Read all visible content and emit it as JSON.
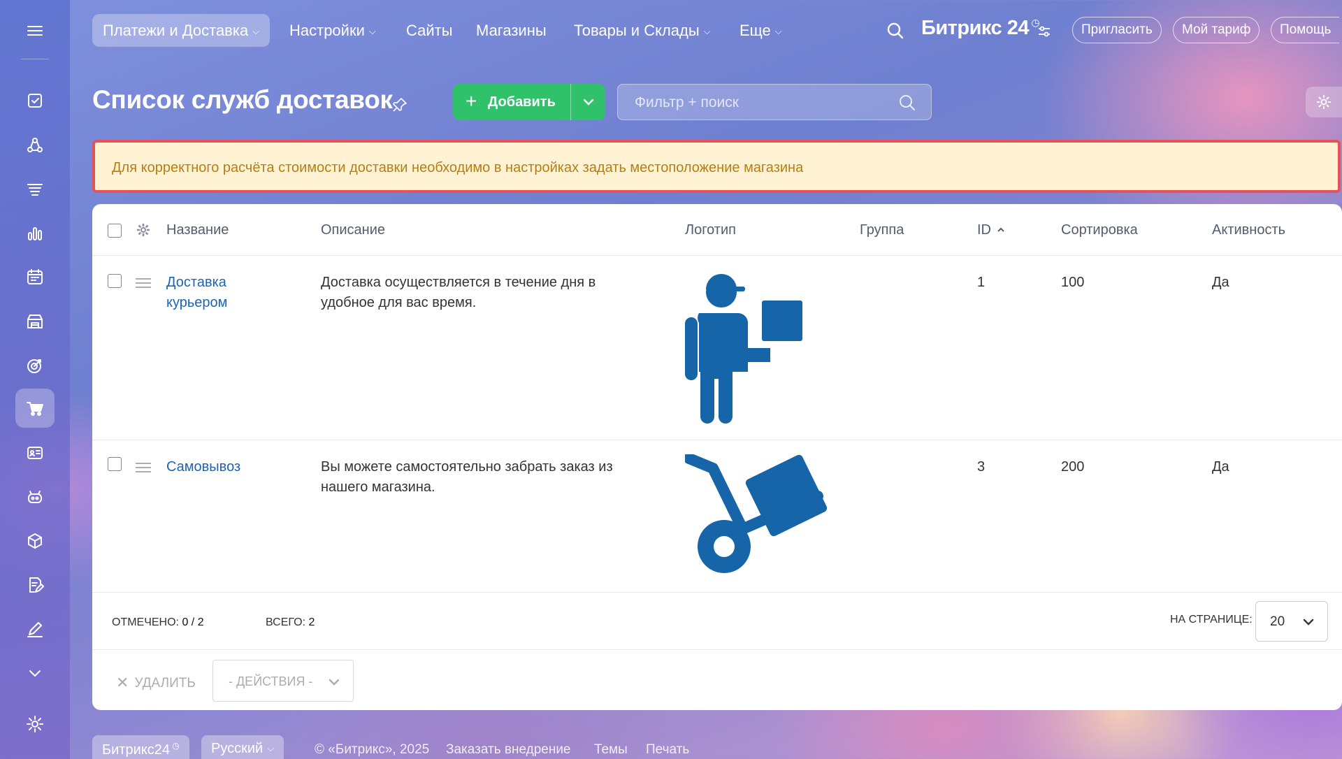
{
  "topnav": {
    "items": [
      {
        "label": "Платежи и Доставка",
        "has_dropdown": true,
        "active": true
      },
      {
        "label": "Настройки",
        "has_dropdown": true
      },
      {
        "label": "Сайты",
        "has_dropdown": false
      },
      {
        "label": "Магазины",
        "has_dropdown": false
      },
      {
        "label": "Товары и Склады",
        "has_dropdown": true
      },
      {
        "label": "Еще",
        "has_dropdown": true
      }
    ],
    "brand": "Битрикс 24",
    "invite": "Пригласить",
    "tariff": "Мой тариф",
    "help": "Помощь"
  },
  "sidebar": {
    "icons": [
      "menu-icon",
      "tasks-icon",
      "crm-icon",
      "funnel-icon",
      "analytics-icon",
      "calendar-icon",
      "store-icon",
      "target-icon",
      "cart-icon",
      "contact-card-icon",
      "robot-icon",
      "box-icon",
      "document-edit-icon",
      "signature-icon",
      "chevron-down-icon",
      "settings-icon"
    ],
    "active": "cart-icon"
  },
  "page": {
    "title": "Список служб доставок",
    "add_button": "Добавить",
    "search_placeholder": "Фильтр + поиск",
    "warning": "Для корректного расчёта стоимости доставки необходимо в настройках задать местоположение магазина"
  },
  "table": {
    "columns": [
      "Название",
      "Описание",
      "Логотип",
      "Группа",
      "ID",
      "Сортировка",
      "Активность"
    ],
    "sort_column": "ID",
    "sort_direction": "asc",
    "rows": [
      {
        "name_line1": "Доставка",
        "name_line2": "курьером",
        "desc_line1": "Доставка осуществляется в течение дня в",
        "desc_line2": "удобное для вас время.",
        "logo": "courier-logo",
        "group": "",
        "id": "1",
        "sort": "100",
        "active": "Да"
      },
      {
        "name_line1": "Самовывоз",
        "name_line2": "",
        "desc_line1": "Вы можете самостоятельно забрать заказ из",
        "desc_line2": "нашего магазина.",
        "logo": "hand-truck-logo",
        "group": "",
        "id": "3",
        "sort": "200",
        "active": "Да"
      }
    ]
  },
  "footer": {
    "selected_label": "ОТМЕЧЕНО:",
    "selected_value": "0 / 2",
    "total_label": "ВСЕГО:",
    "total_value": "2",
    "per_page_label": "НА СТРАНИЦЕ:",
    "per_page_value": "20",
    "delete_label": "УДАЛИТЬ",
    "actions_label": "- ДЕЙСТВИЯ -"
  },
  "bottom": {
    "brand": "Битрикс24",
    "language": "Русский",
    "copyright": "© «Битрикс», 2025",
    "order": "Заказать внедрение",
    "themes": "Темы",
    "print": "Печать"
  },
  "colors": {
    "accent_green": "#2fc26a",
    "link_blue": "#1d64b5",
    "logo_blue": "#1565a8",
    "warning_bg": "#fff3d4",
    "warning_border": "#e4525a",
    "warning_text": "#b77d15"
  }
}
